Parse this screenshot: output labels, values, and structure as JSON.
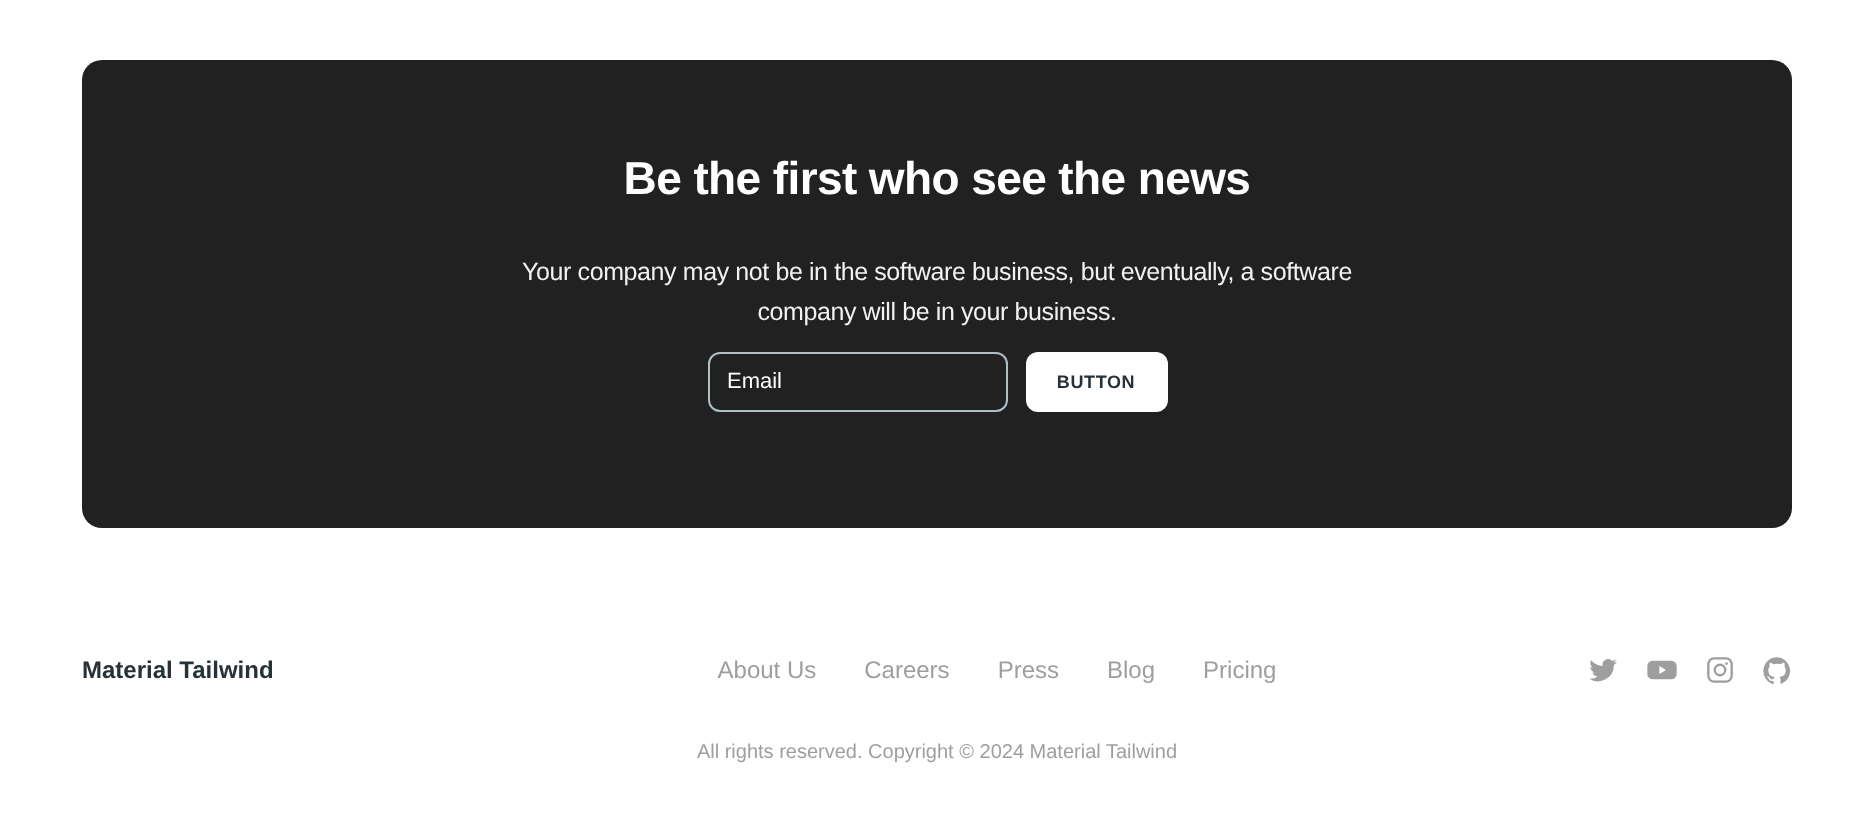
{
  "newsletter": {
    "title": "Be the first who see the news",
    "text": "Your company may not be in the software business, but eventually, a software company will be in your business.",
    "email": {
      "placeholder": "Email"
    },
    "button": "BUTTON"
  },
  "footer": {
    "brand": "Material Tailwind",
    "links": [
      "About Us",
      "Careers",
      "Press",
      "Blog",
      "Pricing"
    ],
    "social": [
      {
        "kind": "twitter"
      },
      {
        "kind": "youtube"
      },
      {
        "kind": "instagram"
      },
      {
        "kind": "github"
      }
    ],
    "copyright": "All rights reserved. Copyright © 2024 Material Tailwind"
  }
}
